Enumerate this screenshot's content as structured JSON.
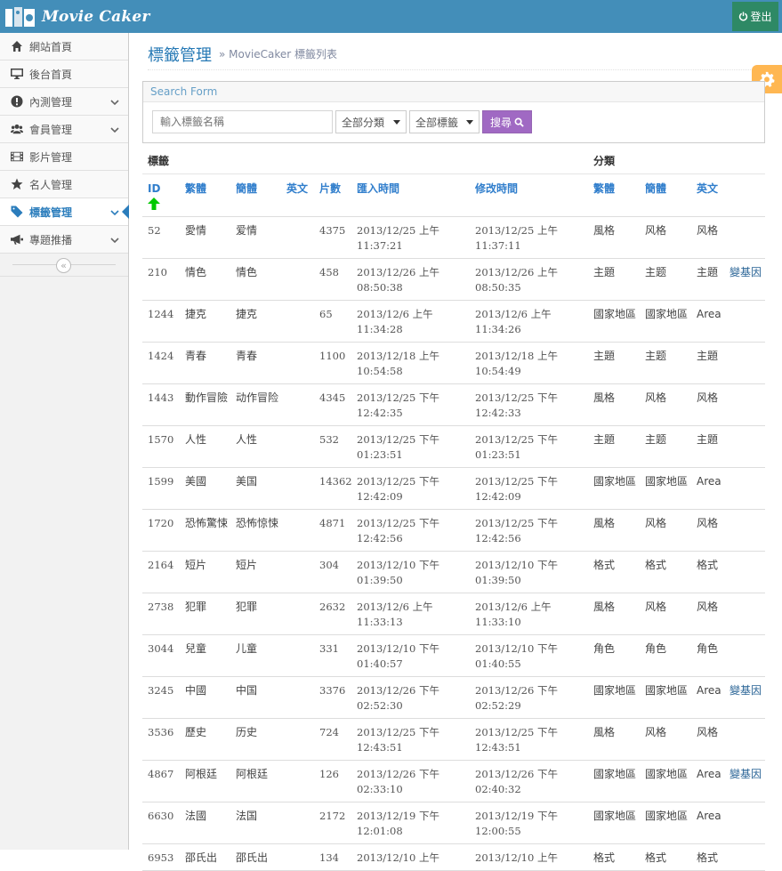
{
  "brand": {
    "name": "Movie Caker"
  },
  "topbar": {
    "logout_label": "登出"
  },
  "sidebar": {
    "items": [
      {
        "label": "網站首頁",
        "icon": "home-icon"
      },
      {
        "label": "後台首頁",
        "icon": "desktop-icon"
      },
      {
        "label": "內測管理",
        "icon": "alert-icon",
        "expandable": true
      },
      {
        "label": "會員管理",
        "icon": "users-icon",
        "expandable": true
      },
      {
        "label": "影片管理",
        "icon": "film-icon"
      },
      {
        "label": "名人管理",
        "icon": "star-icon"
      },
      {
        "label": "標籤管理",
        "icon": "tag-icon",
        "expandable": true,
        "active": true
      },
      {
        "label": "專題推播",
        "icon": "bullhorn-icon",
        "expandable": true
      }
    ],
    "collapse_glyph": "«"
  },
  "header": {
    "title": "標籤管理",
    "subtitle": "MovieCaker 標籤列表"
  },
  "search": {
    "heading": "Search Form",
    "placeholder": "輸入標籤名稱",
    "category_selected": "全部分類",
    "tag_selected": "全部標籤",
    "button_label": "搜尋"
  },
  "table": {
    "group_headers": {
      "tag": "標籤",
      "category": "分類"
    },
    "columns": {
      "id": "ID",
      "trad": "繁體",
      "simp": "簡體",
      "en": "英文",
      "count": "片數",
      "imported": "匯入時間",
      "modified": "修改時間",
      "cat_trad": "繁體",
      "cat_simp": "簡體",
      "cat_en": "英文"
    },
    "rows": [
      {
        "id": "52",
        "trad": "愛情",
        "simp": "爱情",
        "en": "",
        "count": "4375",
        "imported": "2013/12/25 上午 11:37:21",
        "modified": "2013/12/25 上午 11:37:11",
        "cat_trad": "風格",
        "cat_simp": "风格",
        "cat_en": "风格",
        "link": ""
      },
      {
        "id": "210",
        "trad": "情色",
        "simp": "情色",
        "en": "",
        "count": "458",
        "imported": "2013/12/26 上午 08:50:38",
        "modified": "2013/12/26 上午 08:50:35",
        "cat_trad": "主題",
        "cat_simp": "主题",
        "cat_en": "主題",
        "link": "變基因"
      },
      {
        "id": "1244",
        "trad": "捷克",
        "simp": "捷克",
        "en": "",
        "count": "65",
        "imported": "2013/12/6 上午 11:34:28",
        "modified": "2013/12/6 上午 11:34:26",
        "cat_trad": "國家地區",
        "cat_simp": "國家地區",
        "cat_en": "Area",
        "link": ""
      },
      {
        "id": "1424",
        "trad": "青春",
        "simp": "青春",
        "en": "",
        "count": "1100",
        "imported": "2013/12/18 上午 10:54:58",
        "modified": "2013/12/18 上午 10:54:49",
        "cat_trad": "主題",
        "cat_simp": "主题",
        "cat_en": "主題",
        "link": ""
      },
      {
        "id": "1443",
        "trad": "動作冒險",
        "simp": "动作冒险",
        "en": "",
        "count": "4345",
        "imported": "2013/12/25 下午 12:42:35",
        "modified": "2013/12/25 下午 12:42:33",
        "cat_trad": "風格",
        "cat_simp": "风格",
        "cat_en": "风格",
        "link": ""
      },
      {
        "id": "1570",
        "trad": "人性",
        "simp": "人性",
        "en": "",
        "count": "532",
        "imported": "2013/12/25 下午 01:23:51",
        "modified": "2013/12/25 下午 01:23:51",
        "cat_trad": "主題",
        "cat_simp": "主题",
        "cat_en": "主題",
        "link": ""
      },
      {
        "id": "1599",
        "trad": "美國",
        "simp": "美国",
        "en": "",
        "count": "14362",
        "imported": "2013/12/25 下午 12:42:09",
        "modified": "2013/12/25 下午 12:42:09",
        "cat_trad": "國家地區",
        "cat_simp": "國家地區",
        "cat_en": "Area",
        "link": ""
      },
      {
        "id": "1720",
        "trad": "恐怖驚悚",
        "simp": "恐怖惊悚",
        "en": "",
        "count": "4871",
        "imported": "2013/12/25 下午 12:42:56",
        "modified": "2013/12/25 下午 12:42:56",
        "cat_trad": "風格",
        "cat_simp": "风格",
        "cat_en": "风格",
        "link": ""
      },
      {
        "id": "2164",
        "trad": "短片",
        "simp": "短片",
        "en": "",
        "count": "304",
        "imported": "2013/12/10 下午 01:39:50",
        "modified": "2013/12/10 下午 01:39:50",
        "cat_trad": "格式",
        "cat_simp": "格式",
        "cat_en": "格式",
        "link": ""
      },
      {
        "id": "2738",
        "trad": "犯罪",
        "simp": "犯罪",
        "en": "",
        "count": "2632",
        "imported": "2013/12/6 上午 11:33:13",
        "modified": "2013/12/6 上午 11:33:10",
        "cat_trad": "風格",
        "cat_simp": "风格",
        "cat_en": "风格",
        "link": ""
      },
      {
        "id": "3044",
        "trad": "兒童",
        "simp": "儿童",
        "en": "",
        "count": "331",
        "imported": "2013/12/10 下午 01:40:57",
        "modified": "2013/12/10 下午 01:40:55",
        "cat_trad": "角色",
        "cat_simp": "角色",
        "cat_en": "角色",
        "link": ""
      },
      {
        "id": "3245",
        "trad": "中國",
        "simp": "中国",
        "en": "",
        "count": "3376",
        "imported": "2013/12/26 下午 02:52:30",
        "modified": "2013/12/26 下午 02:52:29",
        "cat_trad": "國家地區",
        "cat_simp": "國家地區",
        "cat_en": "Area",
        "link": "變基因"
      },
      {
        "id": "3536",
        "trad": "歷史",
        "simp": "历史",
        "en": "",
        "count": "724",
        "imported": "2013/12/25 下午 12:43:51",
        "modified": "2013/12/25 下午 12:43:51",
        "cat_trad": "風格",
        "cat_simp": "风格",
        "cat_en": "风格",
        "link": ""
      },
      {
        "id": "4867",
        "trad": "阿根廷",
        "simp": "阿根廷",
        "en": "",
        "count": "126",
        "imported": "2013/12/26 下午 02:33:10",
        "modified": "2013/12/26 下午 02:40:32",
        "cat_trad": "國家地區",
        "cat_simp": "國家地區",
        "cat_en": "Area",
        "link": "變基因"
      },
      {
        "id": "6630",
        "trad": "法國",
        "simp": "法国",
        "en": "",
        "count": "2172",
        "imported": "2013/12/19 下午 12:01:08",
        "modified": "2013/12/19 下午 12:00:55",
        "cat_trad": "國家地區",
        "cat_simp": "國家地區",
        "cat_en": "Area",
        "link": ""
      },
      {
        "id": "6953",
        "trad": "邵氏出",
        "simp": "邵氏出",
        "en": "",
        "count": "134",
        "imported": "2013/12/10 上午",
        "modified": "2013/12/10 上午",
        "cat_trad": "格式",
        "cat_simp": "格式",
        "cat_en": "格式",
        "link": ""
      }
    ]
  },
  "colors": {
    "topbar": "#438eb9",
    "logout": "#2e8965",
    "accent": "#2b7dbc",
    "settings": "#ffb752",
    "search_button": "#a069c3",
    "sort_arrow": "#00c800"
  }
}
